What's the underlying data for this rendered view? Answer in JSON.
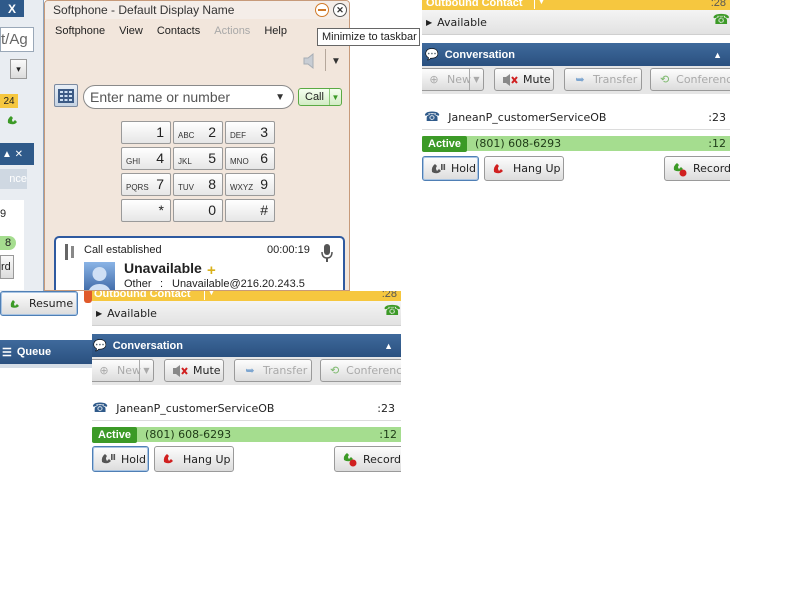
{
  "colors": {
    "accent_blue": "#2f5a8a",
    "yellow_bar": "#f6c73f",
    "active_green": "#3c9a27",
    "call_row_green": "#a5dd8f"
  },
  "left_sliver": {
    "close_glyph": "X",
    "search_fragment": "t/Ag",
    "badge": "24",
    "section_fragment": "nce",
    "count_a": "9",
    "count_b": "8",
    "rd_fragment": "rd",
    "resume_label": "Resume",
    "queue_label": "Queue"
  },
  "softphone": {
    "title": "Softphone - Default Display Name",
    "menu": [
      "Softphone",
      "View",
      "Contacts",
      "Actions",
      "Help"
    ],
    "tooltip": "Minimize to taskbar",
    "search_placeholder": "Enter name or number",
    "call_button": "Call",
    "keypad": [
      {
        "sub": "",
        "num": "1"
      },
      {
        "sub": "ABC",
        "num": "2"
      },
      {
        "sub": "DEF",
        "num": "3"
      },
      {
        "sub": "GHI",
        "num": "4"
      },
      {
        "sub": "JKL",
        "num": "5"
      },
      {
        "sub": "MNO",
        "num": "6"
      },
      {
        "sub": "PQRS",
        "num": "7"
      },
      {
        "sub": "TUV",
        "num": "8"
      },
      {
        "sub": "WXYZ",
        "num": "9"
      },
      {
        "sub": "",
        "num": "*"
      },
      {
        "sub": "",
        "num": "0"
      },
      {
        "sub": "",
        "num": "#"
      }
    ],
    "call_status": "Call established",
    "call_timer": "00:00:19",
    "contact_name": "Unavailable",
    "contact_type": "Other",
    "contact_sep": ":",
    "contact_address": "Unavailable@216.20.243.5"
  },
  "panel_top": {
    "header": "Outbound Contact",
    "header_time": ":28",
    "status": "Available",
    "section": "Conversation",
    "toolbar": [
      "New",
      "Mute",
      "Transfer",
      "Conference"
    ],
    "party_name": "JaneanP_customerServiceOB",
    "party_time": ":23",
    "active_label": "Active",
    "phone": "(801) 608-6293",
    "phone_time": ":12",
    "hold": "Hold",
    "hangup": "Hang Up",
    "record": "Record"
  },
  "panel_bottom": {
    "header": "Outbound Contact",
    "header_time": ":28",
    "status": "Available",
    "section": "Conversation",
    "toolbar": [
      "New",
      "Mute",
      "Transfer",
      "Conference"
    ],
    "party_name": "JaneanP_customerServiceOB",
    "party_time": ":23",
    "active_label": "Active",
    "phone": "(801) 608-6293",
    "phone_time": ":12",
    "hold": "Hold",
    "hangup": "Hang Up",
    "record": "Record"
  }
}
